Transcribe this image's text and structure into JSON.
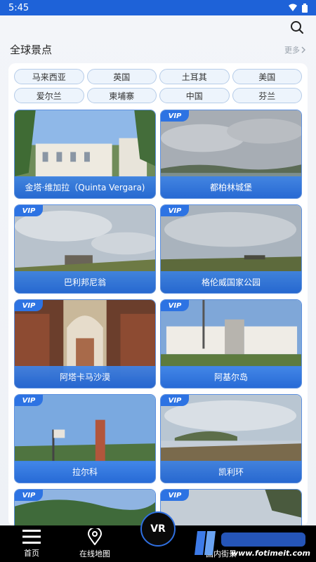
{
  "status_bar": {
    "time": "5:45"
  },
  "header": {
    "section_title": "全球景点",
    "more_label": "更多"
  },
  "categories": [
    "马来西亚",
    "英国",
    "土耳其",
    "美国",
    "爱尔兰",
    "柬埔寨",
    "中国",
    "芬兰"
  ],
  "cards": [
    {
      "caption": "金塔·维加拉（Quinta Vergara)",
      "vip": ""
    },
    {
      "caption": "都柏林城堡",
      "vip": "VIP"
    },
    {
      "caption": "巴利邦尼翁",
      "vip": "VIP"
    },
    {
      "caption": "格伦威国家公园",
      "vip": "VIP"
    },
    {
      "caption": "阿塔卡马沙漠",
      "vip": "VIP"
    },
    {
      "caption": "阿基尔岛",
      "vip": "VIP"
    },
    {
      "caption": "拉尔科",
      "vip": "VIP"
    },
    {
      "caption": "凯利环",
      "vip": "VIP"
    },
    {
      "caption": "",
      "vip": "VIP"
    },
    {
      "caption": "",
      "vip": "VIP"
    }
  ],
  "bottom_nav": {
    "home_label": "首页",
    "map_label": "在线地图",
    "vr_label": "VR",
    "street_label": "国内街景"
  },
  "watermark": {
    "url": "www.fotimeit.com"
  },
  "colors": {
    "accent": "#2d73e3",
    "status_bar": "#1e62d8"
  },
  "icons": {
    "search": "search-icon",
    "home": "menu-icon",
    "map": "location-pin-icon",
    "more": "chevron-right-icon"
  }
}
